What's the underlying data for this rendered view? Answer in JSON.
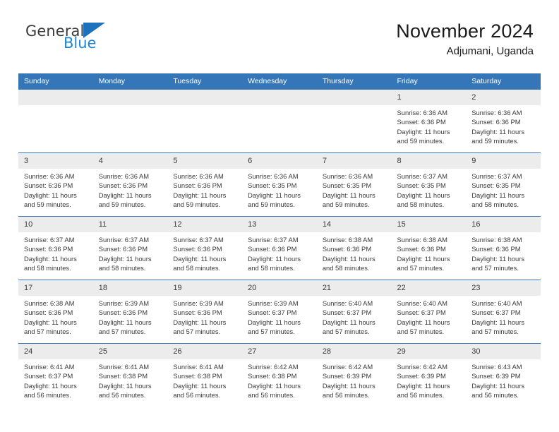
{
  "brand": {
    "name_part1": "General",
    "name_part2": "Blue",
    "triangle_icon": "triangle-icon",
    "accent_color": "#1c86d6"
  },
  "header": {
    "title": "November 2024",
    "subtitle": "Adjumani, Uganda"
  },
  "colors": {
    "header_bar": "#3576b8",
    "daynum_band": "#ececec",
    "text": "#3a3a3a"
  },
  "calendar": {
    "weekday_headers": [
      "Sunday",
      "Monday",
      "Tuesday",
      "Wednesday",
      "Thursday",
      "Friday",
      "Saturday"
    ],
    "weeks": [
      [
        {
          "day": "",
          "blank": true
        },
        {
          "day": "",
          "blank": true
        },
        {
          "day": "",
          "blank": true
        },
        {
          "day": "",
          "blank": true
        },
        {
          "day": "",
          "blank": true
        },
        {
          "day": "1",
          "sunrise": "Sunrise: 6:36 AM",
          "sunset": "Sunset: 6:36 PM",
          "daylight1": "Daylight: 11 hours",
          "daylight2": "and 59 minutes."
        },
        {
          "day": "2",
          "sunrise": "Sunrise: 6:36 AM",
          "sunset": "Sunset: 6:36 PM",
          "daylight1": "Daylight: 11 hours",
          "daylight2": "and 59 minutes."
        }
      ],
      [
        {
          "day": "3",
          "sunrise": "Sunrise: 6:36 AM",
          "sunset": "Sunset: 6:36 PM",
          "daylight1": "Daylight: 11 hours",
          "daylight2": "and 59 minutes."
        },
        {
          "day": "4",
          "sunrise": "Sunrise: 6:36 AM",
          "sunset": "Sunset: 6:36 PM",
          "daylight1": "Daylight: 11 hours",
          "daylight2": "and 59 minutes."
        },
        {
          "day": "5",
          "sunrise": "Sunrise: 6:36 AM",
          "sunset": "Sunset: 6:36 PM",
          "daylight1": "Daylight: 11 hours",
          "daylight2": "and 59 minutes."
        },
        {
          "day": "6",
          "sunrise": "Sunrise: 6:36 AM",
          "sunset": "Sunset: 6:35 PM",
          "daylight1": "Daylight: 11 hours",
          "daylight2": "and 59 minutes."
        },
        {
          "day": "7",
          "sunrise": "Sunrise: 6:36 AM",
          "sunset": "Sunset: 6:35 PM",
          "daylight1": "Daylight: 11 hours",
          "daylight2": "and 59 minutes."
        },
        {
          "day": "8",
          "sunrise": "Sunrise: 6:37 AM",
          "sunset": "Sunset: 6:35 PM",
          "daylight1": "Daylight: 11 hours",
          "daylight2": "and 58 minutes."
        },
        {
          "day": "9",
          "sunrise": "Sunrise: 6:37 AM",
          "sunset": "Sunset: 6:35 PM",
          "daylight1": "Daylight: 11 hours",
          "daylight2": "and 58 minutes."
        }
      ],
      [
        {
          "day": "10",
          "sunrise": "Sunrise: 6:37 AM",
          "sunset": "Sunset: 6:36 PM",
          "daylight1": "Daylight: 11 hours",
          "daylight2": "and 58 minutes."
        },
        {
          "day": "11",
          "sunrise": "Sunrise: 6:37 AM",
          "sunset": "Sunset: 6:36 PM",
          "daylight1": "Daylight: 11 hours",
          "daylight2": "and 58 minutes."
        },
        {
          "day": "12",
          "sunrise": "Sunrise: 6:37 AM",
          "sunset": "Sunset: 6:36 PM",
          "daylight1": "Daylight: 11 hours",
          "daylight2": "and 58 minutes."
        },
        {
          "day": "13",
          "sunrise": "Sunrise: 6:37 AM",
          "sunset": "Sunset: 6:36 PM",
          "daylight1": "Daylight: 11 hours",
          "daylight2": "and 58 minutes."
        },
        {
          "day": "14",
          "sunrise": "Sunrise: 6:38 AM",
          "sunset": "Sunset: 6:36 PM",
          "daylight1": "Daylight: 11 hours",
          "daylight2": "and 58 minutes."
        },
        {
          "day": "15",
          "sunrise": "Sunrise: 6:38 AM",
          "sunset": "Sunset: 6:36 PM",
          "daylight1": "Daylight: 11 hours",
          "daylight2": "and 57 minutes."
        },
        {
          "day": "16",
          "sunrise": "Sunrise: 6:38 AM",
          "sunset": "Sunset: 6:36 PM",
          "daylight1": "Daylight: 11 hours",
          "daylight2": "and 57 minutes."
        }
      ],
      [
        {
          "day": "17",
          "sunrise": "Sunrise: 6:38 AM",
          "sunset": "Sunset: 6:36 PM",
          "daylight1": "Daylight: 11 hours",
          "daylight2": "and 57 minutes."
        },
        {
          "day": "18",
          "sunrise": "Sunrise: 6:39 AM",
          "sunset": "Sunset: 6:36 PM",
          "daylight1": "Daylight: 11 hours",
          "daylight2": "and 57 minutes."
        },
        {
          "day": "19",
          "sunrise": "Sunrise: 6:39 AM",
          "sunset": "Sunset: 6:36 PM",
          "daylight1": "Daylight: 11 hours",
          "daylight2": "and 57 minutes."
        },
        {
          "day": "20",
          "sunrise": "Sunrise: 6:39 AM",
          "sunset": "Sunset: 6:37 PM",
          "daylight1": "Daylight: 11 hours",
          "daylight2": "and 57 minutes."
        },
        {
          "day": "21",
          "sunrise": "Sunrise: 6:40 AM",
          "sunset": "Sunset: 6:37 PM",
          "daylight1": "Daylight: 11 hours",
          "daylight2": "and 57 minutes."
        },
        {
          "day": "22",
          "sunrise": "Sunrise: 6:40 AM",
          "sunset": "Sunset: 6:37 PM",
          "daylight1": "Daylight: 11 hours",
          "daylight2": "and 57 minutes."
        },
        {
          "day": "23",
          "sunrise": "Sunrise: 6:40 AM",
          "sunset": "Sunset: 6:37 PM",
          "daylight1": "Daylight: 11 hours",
          "daylight2": "and 57 minutes."
        }
      ],
      [
        {
          "day": "24",
          "sunrise": "Sunrise: 6:41 AM",
          "sunset": "Sunset: 6:37 PM",
          "daylight1": "Daylight: 11 hours",
          "daylight2": "and 56 minutes."
        },
        {
          "day": "25",
          "sunrise": "Sunrise: 6:41 AM",
          "sunset": "Sunset: 6:38 PM",
          "daylight1": "Daylight: 11 hours",
          "daylight2": "and 56 minutes."
        },
        {
          "day": "26",
          "sunrise": "Sunrise: 6:41 AM",
          "sunset": "Sunset: 6:38 PM",
          "daylight1": "Daylight: 11 hours",
          "daylight2": "and 56 minutes."
        },
        {
          "day": "27",
          "sunrise": "Sunrise: 6:42 AM",
          "sunset": "Sunset: 6:38 PM",
          "daylight1": "Daylight: 11 hours",
          "daylight2": "and 56 minutes."
        },
        {
          "day": "28",
          "sunrise": "Sunrise: 6:42 AM",
          "sunset": "Sunset: 6:39 PM",
          "daylight1": "Daylight: 11 hours",
          "daylight2": "and 56 minutes."
        },
        {
          "day": "29",
          "sunrise": "Sunrise: 6:42 AM",
          "sunset": "Sunset: 6:39 PM",
          "daylight1": "Daylight: 11 hours",
          "daylight2": "and 56 minutes."
        },
        {
          "day": "30",
          "sunrise": "Sunrise: 6:43 AM",
          "sunset": "Sunset: 6:39 PM",
          "daylight1": "Daylight: 11 hours",
          "daylight2": "and 56 minutes."
        }
      ]
    ]
  }
}
